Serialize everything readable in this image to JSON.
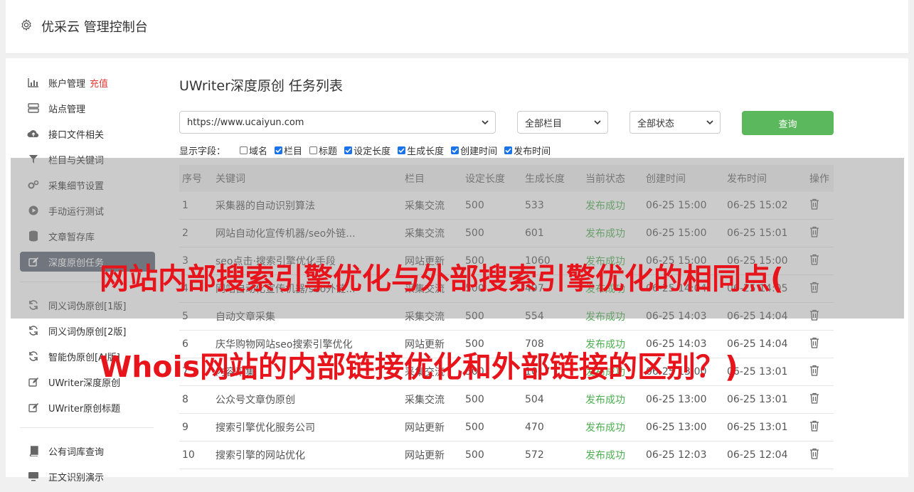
{
  "header": {
    "brand": "优采云 管理控制台"
  },
  "sidebar": {
    "items": [
      {
        "label": "账户管理",
        "badge": "充值",
        "icon": "bar-chart-icon"
      },
      {
        "label": "站点管理",
        "icon": "server-icon"
      },
      {
        "label": "接口文件相关",
        "icon": "cloud-upload-icon"
      },
      {
        "label": "栏目与关键词",
        "icon": "filter-icon"
      },
      {
        "label": "采集细节设置",
        "icon": "gears-icon"
      },
      {
        "label": "手动运行测试",
        "icon": "play-circle-icon"
      },
      {
        "label": "文章暂存库",
        "icon": "database-icon"
      },
      {
        "label": "深度原创任务",
        "icon": "edit-icon",
        "active": true
      },
      {
        "label": "同义词伪原创[1版]",
        "icon": "refresh-icon"
      },
      {
        "label": "同义词伪原创[2版]",
        "icon": "refresh-icon"
      },
      {
        "label": "智能伪原创[AI版]",
        "icon": "refresh-icon"
      },
      {
        "label": "UWriter深度原创",
        "icon": "edit-icon"
      },
      {
        "label": "UWriter原创标题",
        "icon": "edit-icon"
      },
      {
        "label": "公有词库查询",
        "icon": "book-icon"
      },
      {
        "label": "正文识别演示",
        "icon": "monitor-icon"
      }
    ]
  },
  "main": {
    "title": "UWriter深度原创 任务列表",
    "site_select": "https://www.ucaiyun.com",
    "column_select": "全部栏目",
    "status_select": "全部状态",
    "query_label": "查询",
    "fields_label": "显示字段：",
    "fields": [
      {
        "label": "域名",
        "checked": false
      },
      {
        "label": "栏目",
        "checked": true
      },
      {
        "label": "标题",
        "checked": false
      },
      {
        "label": "设定长度",
        "checked": true
      },
      {
        "label": "生成长度",
        "checked": true
      },
      {
        "label": "创建时间",
        "checked": true
      },
      {
        "label": "发布时间",
        "checked": true
      }
    ],
    "columns": [
      "序号",
      "关键词",
      "栏目",
      "设定长度",
      "生成长度",
      "当前状态",
      "创建时间",
      "发布时间",
      "操作"
    ],
    "rows": [
      [
        "1",
        "采集器的自动识别算法",
        "采集交流",
        "500",
        "533",
        "发布成功",
        "06-25 15:00",
        "06-25 15:02"
      ],
      [
        "2",
        "网站自动化宣传机器/seo外链...",
        "采集交流",
        "500",
        "601",
        "发布成功",
        "06-25 15:00",
        "06-25 15:01"
      ],
      [
        "3",
        "seo点击·搜索引擎优化手段",
        "网站更新",
        "500",
        "1060",
        "发布成功",
        "06-25 15:00",
        "06-25 15:00"
      ],
      [
        "4",
        "网站自动化宣传机器/seo外链...",
        "采集交流",
        "500",
        "497",
        "发布成功",
        "06-25 14:04",
        "06-25 14:05"
      ],
      [
        "5",
        "自动文章采集",
        "采集交流",
        "500",
        "554",
        "发布成功",
        "06-25 14:03",
        "06-25 14:04"
      ],
      [
        "6",
        "庆华购物网站seo搜索引擎优化",
        "网站更新",
        "500",
        "708",
        "发布成功",
        "06-25 14:03",
        "06-25 14:04"
      ],
      [
        "7",
        "内容采集",
        "采集交流",
        "500",
        "1017",
        "发布成功",
        "06-25 13:00",
        "06-25 13:01"
      ],
      [
        "8",
        "公众号文章伪原创",
        "采集交流",
        "500",
        "504",
        "发布成功",
        "06-25 13:00",
        "06-25 13:01"
      ],
      [
        "9",
        "搜索引擎优化服务公司",
        "网站更新",
        "500",
        "470",
        "发布成功",
        "06-25 13:00",
        "06-25 13:01"
      ],
      [
        "10",
        "搜索引擎的网站优化",
        "网站更新",
        "500",
        "572",
        "发布成功",
        "06-25 12:03",
        "06-25 12:04"
      ]
    ]
  },
  "overlay": {
    "line1": "网站内部搜索引擎优化与外部搜索引擎优化的相同点(",
    "line2": "Whois网站的内部链接优化和外部链接的区别？)"
  },
  "colors": {
    "accent_green": "#5cb85c",
    "active_item": "#5b6574",
    "headline_red": "#e8141b"
  }
}
